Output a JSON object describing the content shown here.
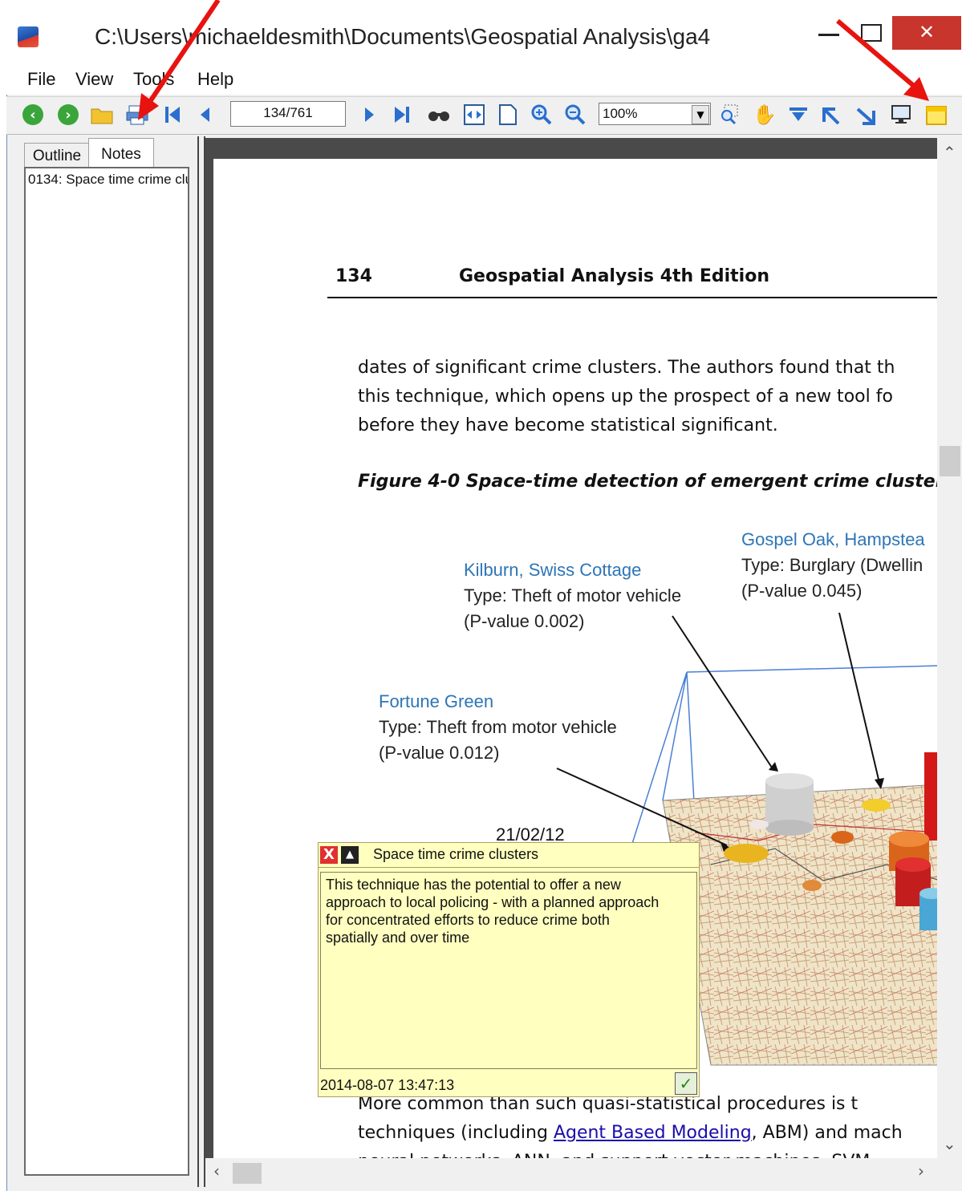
{
  "window": {
    "title": "C:\\Users\\michaeldesmith\\Documents\\Geospatial Analysis\\ga4",
    "close_glyph": "✕"
  },
  "menu": [
    "File",
    "View",
    "Tools",
    "Help"
  ],
  "toolbar": {
    "page_indicator": "134/761",
    "zoom": "100%",
    "icons": [
      "back-icon",
      "forward-icon",
      "open-folder-icon",
      "print-icon",
      "first-page-icon",
      "prev-page-icon",
      "next-page-icon",
      "last-page-icon",
      "find-icon",
      "fit-width-icon",
      "fit-page-icon",
      "zoom-in-icon",
      "zoom-out-icon",
      "zoom-select-icon",
      "hand-icon",
      "rotate-down-icon",
      "rotate-left-icon",
      "rotate-right-icon",
      "fullscreen-icon",
      "notes-icon"
    ]
  },
  "left_panel": {
    "tabs": [
      "Outline",
      "Notes"
    ],
    "active_tab": "Notes",
    "notes": [
      "0134: Space time crime clu"
    ]
  },
  "page": {
    "number": "134",
    "header": "Geospatial Analysis 4th Edition",
    "lines": [
      "dates of significant crime clusters. The authors found that th",
      "this technique, which opens up the prospect of a new tool fo",
      "before they have become statistical significant."
    ],
    "figure_caption": "Figure 4-0 Space-time detection of emergent crime cluster",
    "labels": {
      "gospel": {
        "name": "Gospel Oak, Hampstea",
        "type": "Type: Burglary (Dwellin",
        "p": "(P-value 0.045)"
      },
      "kilburn": {
        "name": "Kilburn, Swiss Cottage",
        "type": "Type: Theft of motor vehicle",
        "p": "(P-value 0.002)"
      },
      "fortune": {
        "name": "Fortune Green",
        "type": "Type: Theft from motor vehicle",
        "p": "(P-value 0.012)"
      }
    },
    "date_label": "21/02/12",
    "after_lines": {
      "line1": "More common than such quasi-statistical procedures is t",
      "line2_pre": "techniques (including ",
      "line2_link": "Agent Based Modeling",
      "line2_post": ", ABM) and mach",
      "line3": "neural networks, ANN, and support vector machines, SVM"
    }
  },
  "note_popup": {
    "title": "Space time crime clusters",
    "body": "This technique has the potential to offer a new\napproach to local policing - with a planned approach\nfor concentrated efforts to reduce crime both\nspatially and over time",
    "timestamp": "2014-08-07 13:47:13",
    "close_glyph": "X",
    "collapse_glyph": "▲",
    "ok_glyph": "✓"
  },
  "colors": {
    "annotation_arrow": "#e8130f",
    "label_blue": "#2e75b6",
    "note_bg": "#ffffc0"
  }
}
